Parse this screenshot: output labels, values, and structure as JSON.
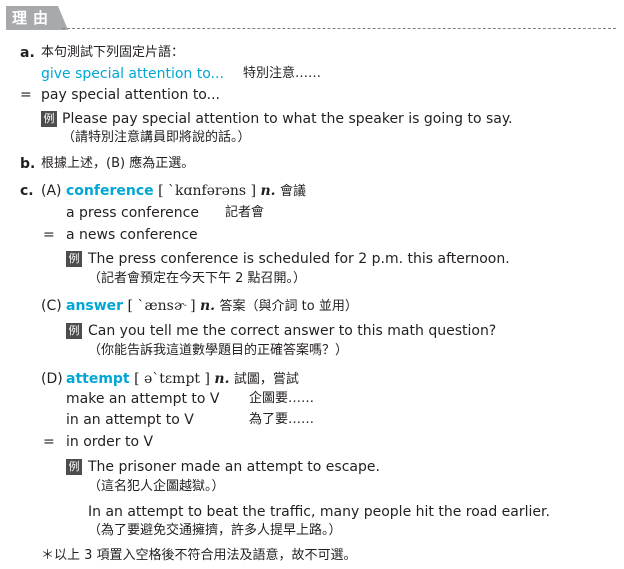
{
  "header": {
    "title": "理由"
  },
  "a": {
    "label": "a.",
    "intro": "本句測試下列固定片語：",
    "phrase": "give special attention to...",
    "phrase_zh": "特別注意……",
    "eq": "=",
    "synonym": "pay special attention to...",
    "ex_mark": "例",
    "example_en": "Please pay special attention to what the speaker is going to say.",
    "example_zh": "（請特別注意講員即將說的話。）"
  },
  "b": {
    "label": "b.",
    "text": "根據上述，(B) 應為正選。"
  },
  "c": {
    "label": "c.",
    "A": {
      "opt": "(A)",
      "word": "conference",
      "ipa": "[ ˋkɑnfərəns ]",
      "pos": "n.",
      "meaning": "會議",
      "phrase1": "a press conference",
      "phrase1_zh": "記者會",
      "eq": "=",
      "phrase2": "a news conference",
      "ex_mark": "例",
      "example_en": "The press conference is scheduled for 2 p.m. this afternoon.",
      "example_zh": "（記者會預定在今天下午 2 點召開。）"
    },
    "C": {
      "opt": "(C)",
      "word": "answer",
      "ipa": "[ ˋænsɚ ]",
      "pos": "n.",
      "meaning": "答案（與介詞 to 並用）",
      "ex_mark": "例",
      "example_en": "Can you tell me the correct answer to this math question?",
      "example_zh": "（你能告訴我這道數學題目的正確答案嗎？）"
    },
    "D": {
      "opt": "(D)",
      "word": "attempt",
      "ipa": "[ əˋtɛmpt ]",
      "pos": "n.",
      "meaning": "試圖，嘗試",
      "phrase1": "make an attempt to V",
      "phrase1_zh": "企圖要……",
      "phrase2": "in an attempt to V",
      "phrase2_zh": "為了要……",
      "eq": "=",
      "phrase3": "in order to V",
      "ex_mark": "例",
      "example1_en": "The prisoner made an attempt to escape.",
      "example1_zh": "（這名犯人企圖越獄。）",
      "example2_en": "In an attempt to beat the traffic, many people hit the road earlier.",
      "example2_zh": "（為了要避免交通擁擠，許多人提早上路。）"
    },
    "note": "＊以上 3 項置入空格後不符合用法及語意，故不可選。"
  }
}
